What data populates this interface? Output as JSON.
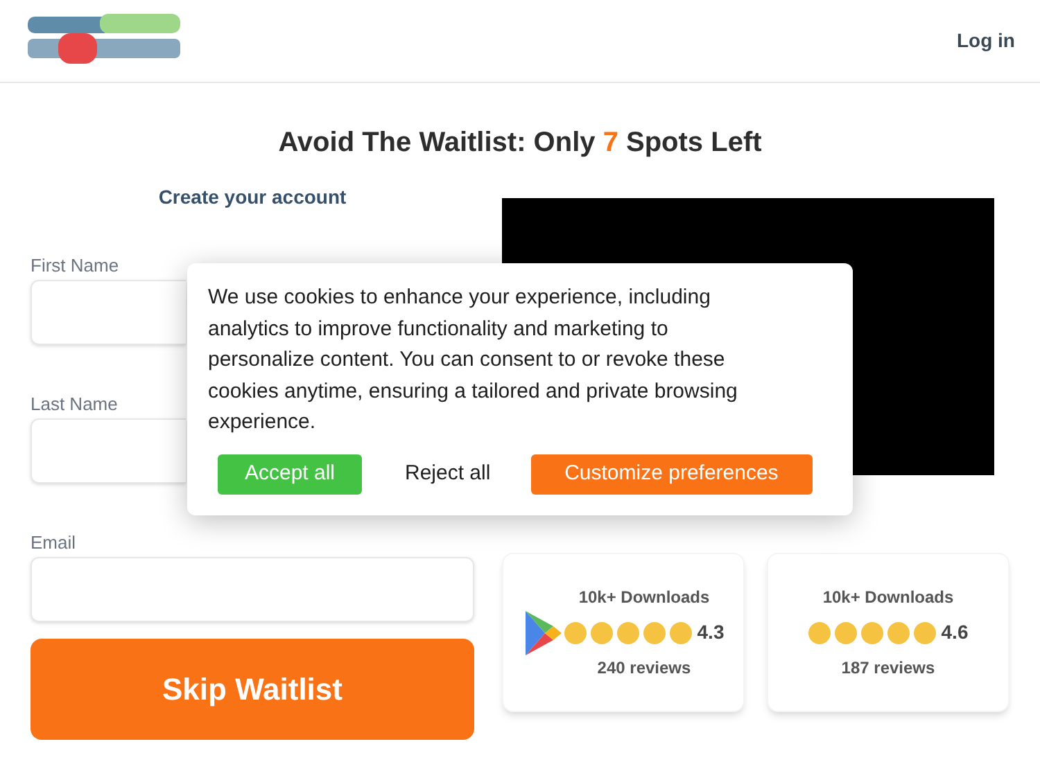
{
  "header": {
    "login": "Log in"
  },
  "headline": {
    "before": "Avoid The Waitlist: Only",
    "count": "7",
    "after": "Spots Left"
  },
  "form": {
    "title": "Create your account",
    "fields": [
      {
        "label": "First Name"
      },
      {
        "label": "Last Name"
      },
      {
        "label": "Email"
      }
    ],
    "submit": "Skip Waitlist"
  },
  "ratings": [
    {
      "kind": "play",
      "downloads": "10k+ Downloads",
      "stars": 5,
      "score": "4.3",
      "reviews": "240 reviews"
    },
    {
      "kind": "plain",
      "downloads": "10k+ Downloads",
      "stars": 5,
      "score": "4.6",
      "reviews": "187 reviews"
    }
  ],
  "cookie_dialog": {
    "message": "We use cookies to enhance your experience, including analytics to improve functionality and marketing to personalize content. You can consent to or revoke these cookies anytime, ensuring a tailored and private browsing experience.",
    "buttons": [
      {
        "kind": "accept",
        "label": "Accept all"
      },
      {
        "kind": "reject",
        "label": "Reject all"
      },
      {
        "kind": "customize",
        "label": "Customize preferences"
      }
    ]
  }
}
